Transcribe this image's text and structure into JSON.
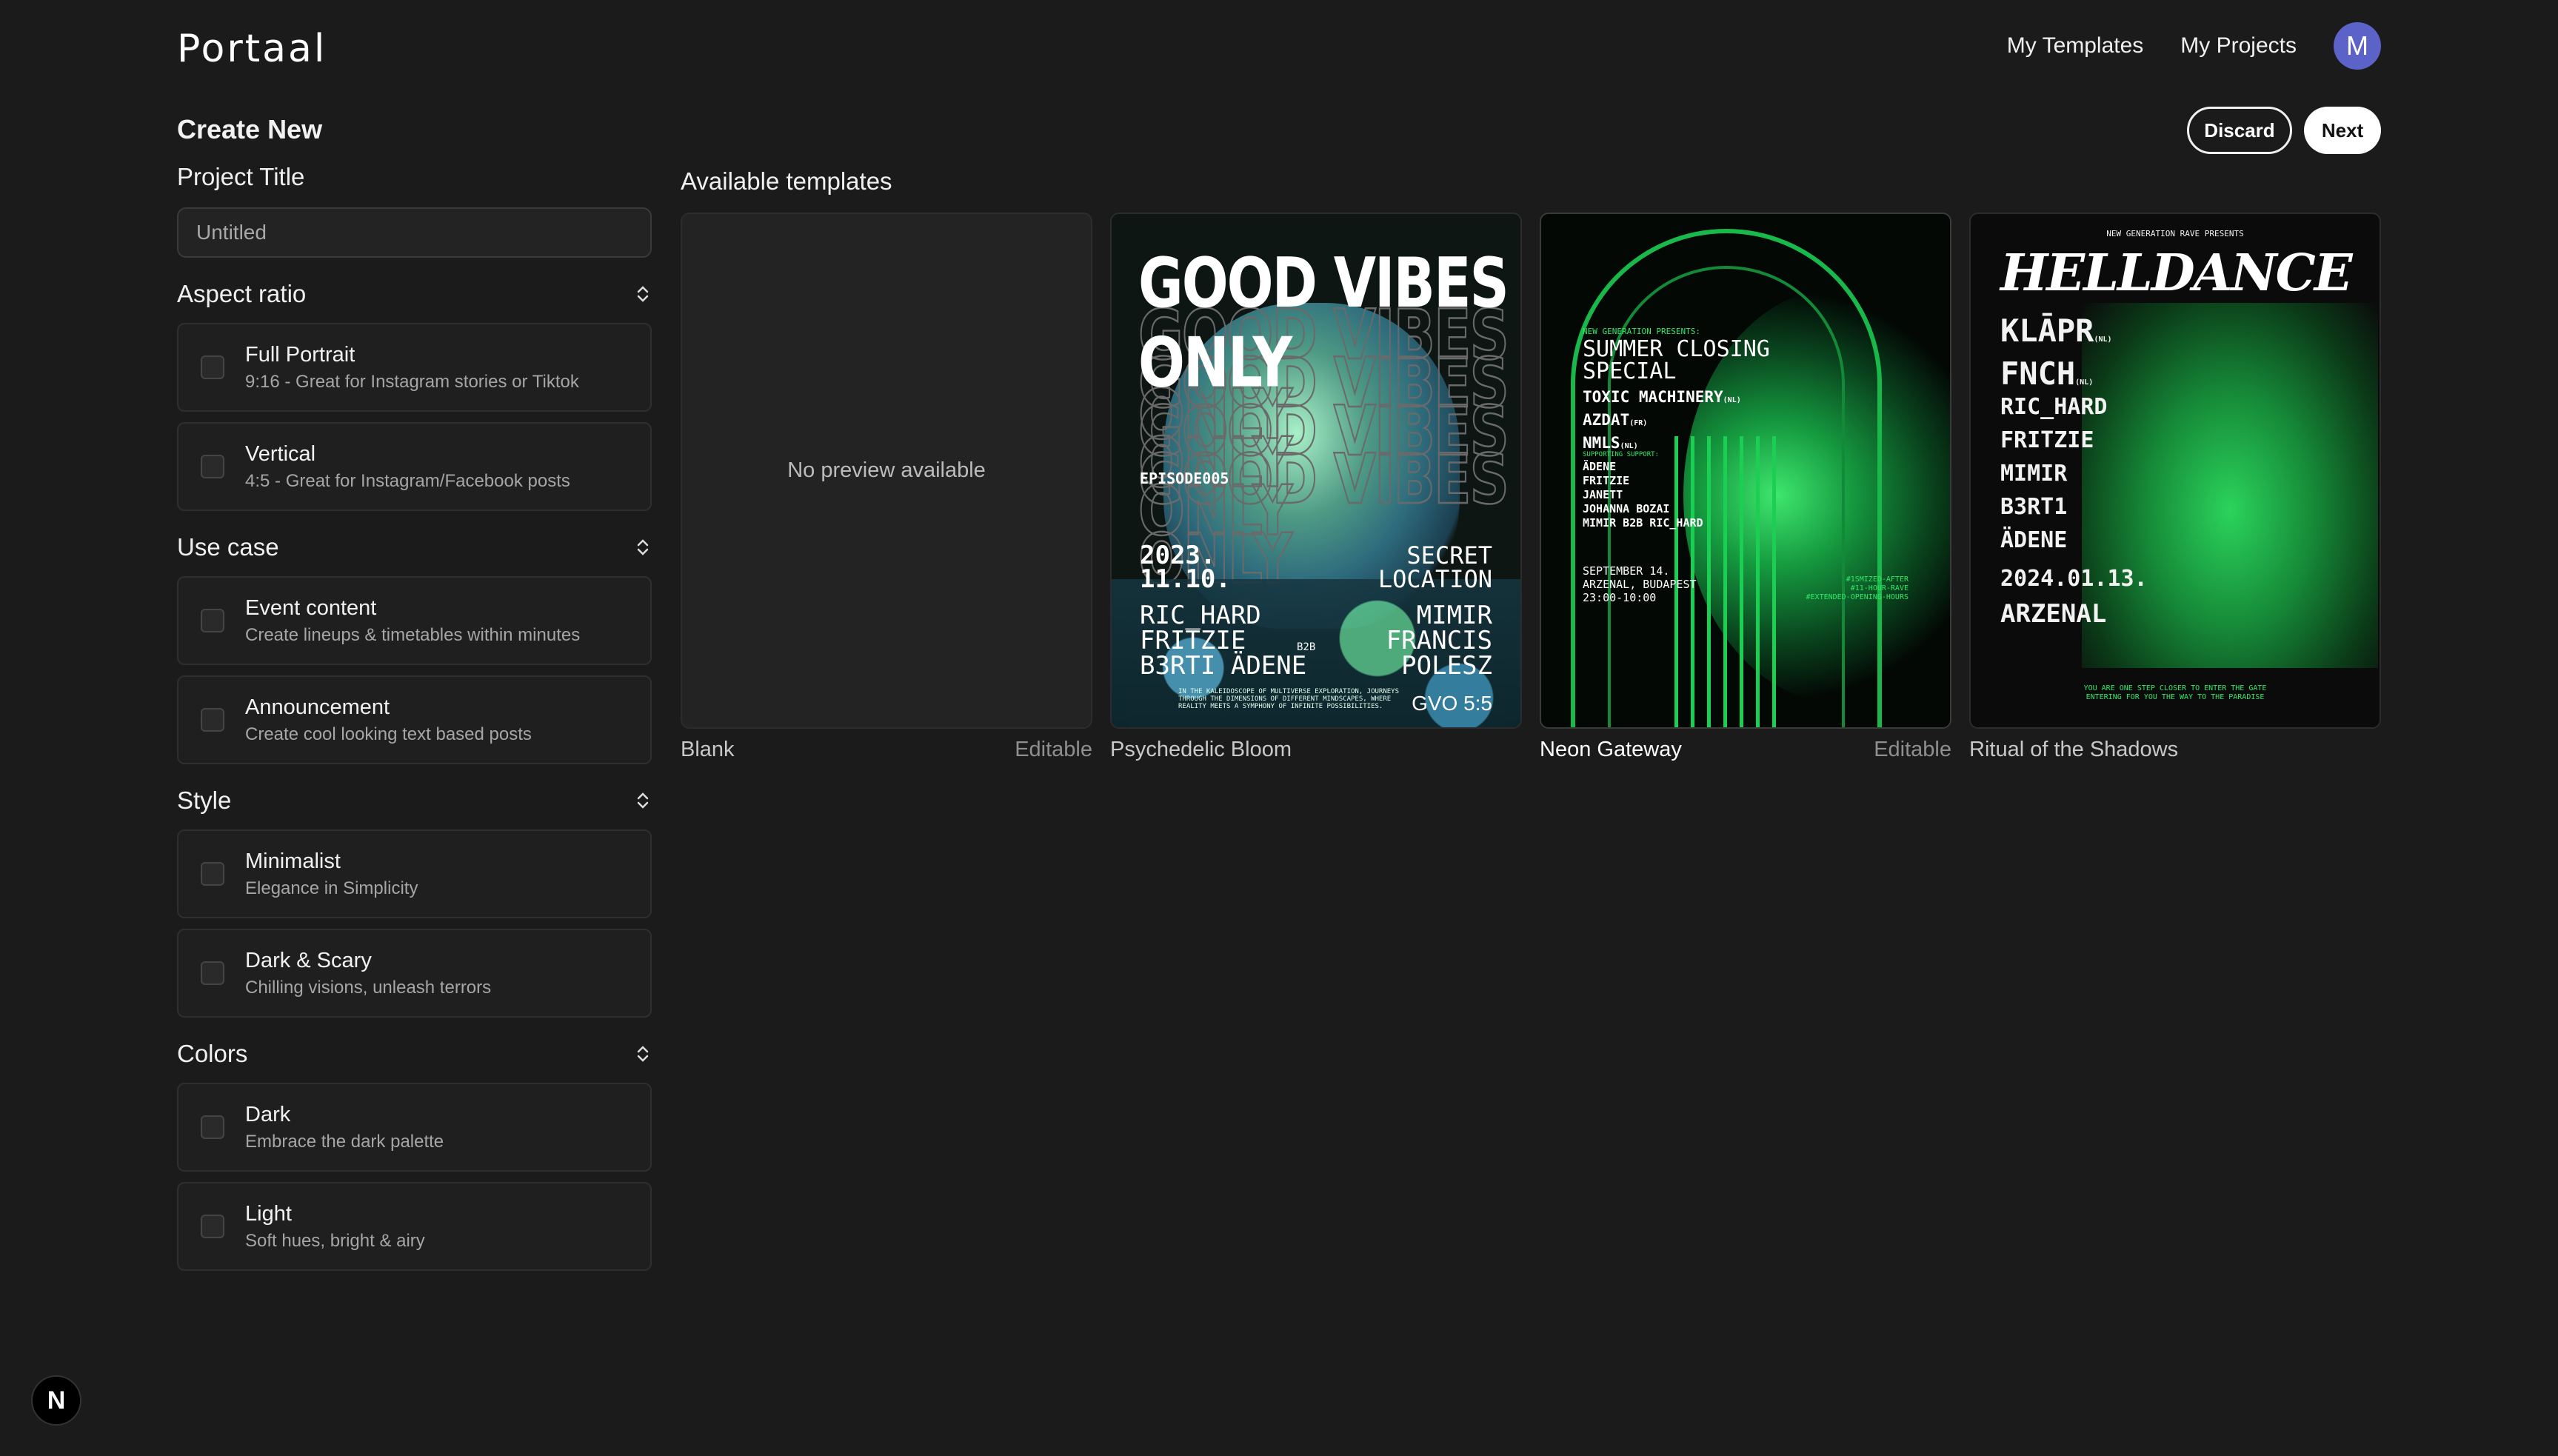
{
  "header": {
    "logo": "Portaal",
    "nav": [
      "My Templates",
      "My Projects"
    ],
    "avatar_initial": "M",
    "avatar_color": "#5b63c9"
  },
  "page": {
    "title": "Create New",
    "discard_label": "Discard",
    "next_label": "Next"
  },
  "sidebar": {
    "project_title_label": "Project Title",
    "project_title_placeholder": "Untitled",
    "sections": [
      {
        "label": "Aspect ratio",
        "options": [
          {
            "title": "Full Portrait",
            "desc": "9:16 - Great for Instagram stories or Tiktok"
          },
          {
            "title": "Vertical",
            "desc": "4:5 - Great for Instagram/Facebook posts"
          }
        ]
      },
      {
        "label": "Use case",
        "options": [
          {
            "title": "Event content",
            "desc": "Create lineups & timetables within minutes"
          },
          {
            "title": "Announcement",
            "desc": "Create cool looking text based posts"
          }
        ]
      },
      {
        "label": "Style",
        "options": [
          {
            "title": "Minimalist",
            "desc": "Elegance in Simplicity"
          },
          {
            "title": "Dark & Scary",
            "desc": "Chilling visions, unleash terrors"
          }
        ]
      },
      {
        "label": "Colors",
        "options": [
          {
            "title": "Dark",
            "desc": "Embrace the dark palette"
          },
          {
            "title": "Light",
            "desc": "Soft hues, bright & airy"
          }
        ]
      }
    ]
  },
  "templates": {
    "label": "Available templates",
    "no_preview": "No preview available",
    "items": [
      {
        "name": "Blank",
        "tag": "Editable"
      },
      {
        "name": "Psychedelic Bloom",
        "tag": ""
      },
      {
        "name": "Neon Gateway",
        "tag": "Editable"
      },
      {
        "name": "Ritual of the Shadows",
        "tag": ""
      }
    ]
  },
  "posters": {
    "bloom": {
      "headline": "GOOD VIBES ONLY",
      "episode": "EPISODE005",
      "date": "2023.\n11.10.",
      "location": "SECRET\nLOCATION",
      "lineup_left": [
        "RIC_HARD",
        "FRITZIE",
        "B3RTI"
      ],
      "lineup_right": [
        "MIMIR",
        "FRANCIS",
        "POLESZ"
      ],
      "b2b": "B2B",
      "adene": "ÄDENE",
      "footer": "IN THE KALEIDOSCOPE OF MULTIVERSE EXPLORATION, JOURNEYS THROUGH THE DIMENSIONS OF DIFFERENT MINDSCAPES, WHERE REALITY MEETS A SYMPHONY OF INFINITE POSSIBILITIES.",
      "signature": "GVO 5:5"
    },
    "neon": {
      "presents": "NEW GENERATION PRESENTS:",
      "title": "SUMMER CLOSING\nSPECIAL",
      "headliners": [
        "TOXIC MACHINERY",
        "AZDAT",
        "NMLS"
      ],
      "headliner_tags": [
        "(NL)",
        "(FR)",
        "(NL)"
      ],
      "support_label": "SUPPORTING SUPPORT:",
      "support": [
        "ÄDENE",
        "FRITZIE",
        "JANETT",
        "JOHANNA BOZAI",
        "MIMIR B2B RIC_HARD"
      ],
      "when": "SEPTEMBER 14.\nARZENAL, BUDAPEST\n23:00-10:00",
      "extras": "#1SMIZED-AFTER\n#11-HOUR-RAVE\n#EXTENDED-OPENING-HOURS"
    },
    "ritual": {
      "presents": "NEW GENERATION RAVE PRESENTS",
      "title": "HELLDANCE",
      "lineup": [
        "KLĀPR",
        "FNCH",
        "RIC_HARD",
        "FRITZIE",
        "MIMIR",
        "B3RT1",
        "ÄDENE"
      ],
      "lineup_tags": [
        "(NL)",
        "(NL)",
        "",
        "",
        "",
        "",
        ""
      ],
      "date": "2024.01.13.",
      "venue": "ARZENAL",
      "footer": "YOU ARE ONE STEP CLOSER TO ENTER THE GATE\nENTERING FOR YOU THE WAY TO THE PARADISE"
    }
  },
  "badge": "N"
}
